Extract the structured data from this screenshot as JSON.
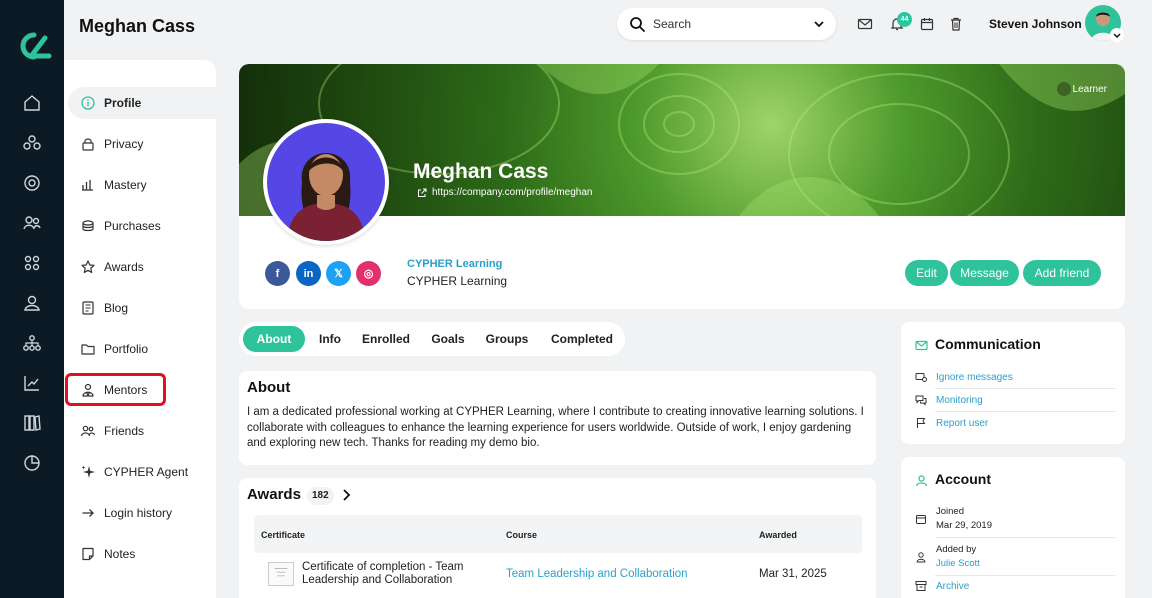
{
  "header": {
    "title": "Meghan Cass",
    "search_placeholder": "Search",
    "notification_count": "44",
    "user_name": "Steven Johnson"
  },
  "rail": {
    "icons": [
      "home-icon",
      "modules-icon",
      "target-icon",
      "people-icon",
      "grid-icon",
      "user-icon",
      "hierarchy-icon",
      "chart-icon",
      "library-icon",
      "pie-icon"
    ]
  },
  "nav": {
    "items": [
      {
        "label": "Profile",
        "icon": "info-icon"
      },
      {
        "label": "Privacy",
        "icon": "lock-icon"
      },
      {
        "label": "Mastery",
        "icon": "bars-icon"
      },
      {
        "label": "Purchases",
        "icon": "coins-icon"
      },
      {
        "label": "Awards",
        "icon": "star-icon"
      },
      {
        "label": "Blog",
        "icon": "blog-icon"
      },
      {
        "label": "Portfolio",
        "icon": "folder-icon"
      },
      {
        "label": "Mentors",
        "icon": "mentor-icon"
      },
      {
        "label": "Friends",
        "icon": "friends-icon"
      },
      {
        "label": "CYPHER Agent",
        "icon": "sparkle-icon"
      },
      {
        "label": "Login history",
        "icon": "arrow-right-icon"
      },
      {
        "label": "Notes",
        "icon": "note-icon"
      }
    ]
  },
  "profile": {
    "name": "Meghan Cass",
    "url": "https://company.com/profile/meghan",
    "role": "Learner",
    "org_link": "CYPHER Learning",
    "org_name": "CYPHER Learning",
    "buttons": {
      "edit": "Edit",
      "message": "Message",
      "add_friend": "Add friend"
    },
    "social": [
      {
        "name": "facebook",
        "glyph": "f",
        "color": "#3b5998"
      },
      {
        "name": "linkedin",
        "glyph": "in",
        "color": "#0a66c2"
      },
      {
        "name": "x",
        "glyph": "𝕏",
        "color": "#1da1f2"
      },
      {
        "name": "instagram",
        "glyph": "◎",
        "color": "#e1306c"
      }
    ]
  },
  "tabs": [
    "About",
    "Info",
    "Enrolled",
    "Goals",
    "Groups",
    "Completed"
  ],
  "about": {
    "title": "About",
    "text": "I am a dedicated professional working at CYPHER Learning, where I contribute to creating innovative learning solutions. I collaborate with colleagues to enhance the learning experience for users worldwide. Outside of work, I enjoy gardening and exploring new tech. Thanks for reading my demo bio."
  },
  "awards": {
    "title": "Awards",
    "count": "182",
    "columns": [
      "Certificate",
      "Course",
      "Awarded"
    ],
    "rows": [
      {
        "certificate": "Certificate of completion - Team Leadership and Collaboration",
        "course": "Team Leadership and Collaboration",
        "awarded": "Mar 31, 2025"
      }
    ]
  },
  "communication": {
    "title": "Communication",
    "items": [
      "Ignore messages",
      "Monitoring",
      "Report user"
    ]
  },
  "account": {
    "title": "Account",
    "joined_label": "Joined",
    "joined_value": "Mar 29, 2019",
    "added_by_label": "Added by",
    "added_by_value": "Julie Scott",
    "archive": "Archive"
  }
}
